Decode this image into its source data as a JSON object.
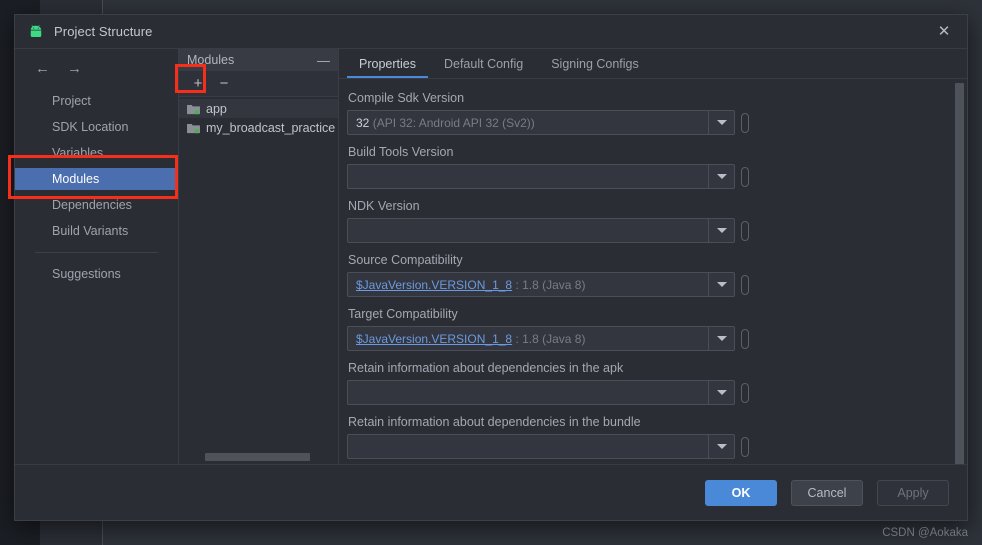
{
  "window": {
    "title": "Project Structure",
    "app_icon": "android-robot-icon",
    "close_label": "✕"
  },
  "nav": {
    "back_icon": "←",
    "forward_icon": "→",
    "items": [
      {
        "label": "Project",
        "selected": false
      },
      {
        "label": "SDK Location",
        "selected": false
      },
      {
        "label": "Variables",
        "selected": false
      },
      {
        "label": "Modules",
        "selected": true
      },
      {
        "label": "Dependencies",
        "selected": false
      },
      {
        "label": "Build Variants",
        "selected": false
      }
    ],
    "suggestions_label": "Suggestions"
  },
  "modules_panel": {
    "header_title": "Modules",
    "collapse_icon": "—",
    "add_label": "+",
    "remove_label": "−",
    "items": [
      {
        "name": "app",
        "selected": true
      },
      {
        "name": "my_broadcast_practice",
        "selected": false
      }
    ]
  },
  "tabs": [
    {
      "label": "Properties",
      "active": true
    },
    {
      "label": "Default Config",
      "active": false
    },
    {
      "label": "Signing Configs",
      "active": false
    }
  ],
  "fields": [
    {
      "label": "Compile Sdk Version",
      "value": "32",
      "hint": "(API 32: Android API 32 (Sv2))",
      "variable": "",
      "value_kind": "plain"
    },
    {
      "label": "Build Tools Version",
      "value": "",
      "hint": "",
      "variable": "",
      "value_kind": "empty"
    },
    {
      "label": "NDK Version",
      "value": "",
      "hint": "",
      "variable": "",
      "value_kind": "empty"
    },
    {
      "label": "Source Compatibility",
      "value": "",
      "hint": ": 1.8 (Java 8)",
      "variable": "$JavaVersion.VERSION_1_8",
      "value_kind": "variable"
    },
    {
      "label": "Target Compatibility",
      "value": "",
      "hint": ": 1.8 (Java 8)",
      "variable": "$JavaVersion.VERSION_1_8",
      "value_kind": "variable"
    },
    {
      "label": "Retain information about dependencies in the apk",
      "value": "",
      "hint": "",
      "variable": "",
      "value_kind": "empty"
    },
    {
      "label": "Retain information about dependencies in the bundle",
      "value": "",
      "hint": "",
      "variable": "",
      "value_kind": "empty"
    }
  ],
  "footer": {
    "ok_label": "OK",
    "cancel_label": "Cancel",
    "apply_label": "Apply"
  },
  "watermark": "CSDN @Aokaka",
  "colors": {
    "accent_blue": "#4a88d8",
    "selection_blue": "#4b6eaf",
    "annotation_red": "#f52f1a",
    "variable_link": "#6b9ae0",
    "dialog_bg": "#2b2d34"
  }
}
